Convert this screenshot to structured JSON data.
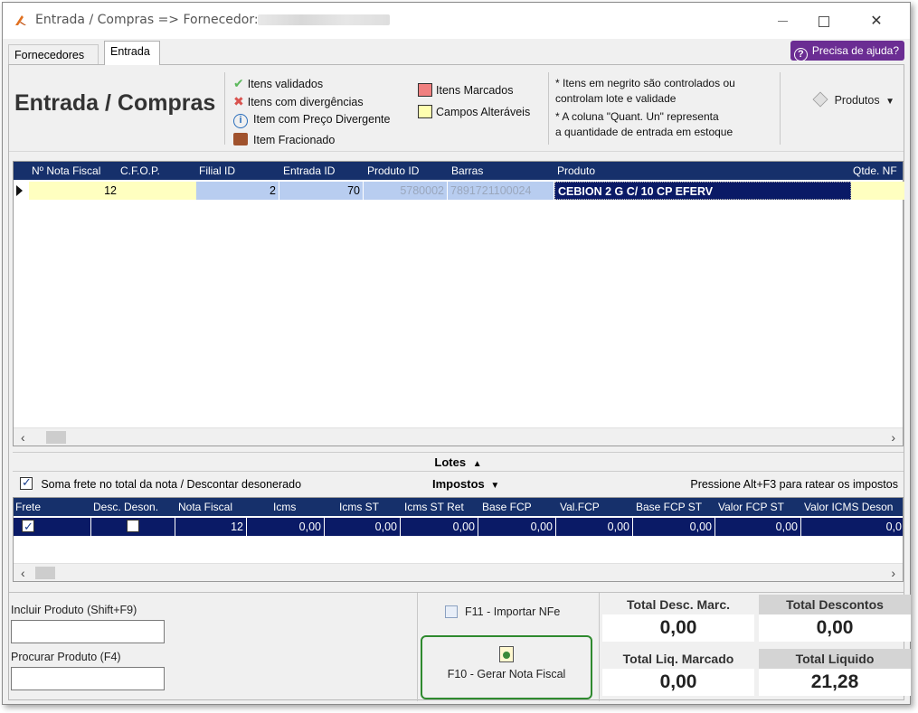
{
  "window": {
    "title": "Entrada / Compras => Fornecedor:",
    "minimize_label": "—",
    "maximize_label": "",
    "close_label": "✕"
  },
  "tabs": [
    {
      "label": "Fornecedores",
      "active": false
    },
    {
      "label": "Entrada",
      "active": true
    }
  ],
  "help": {
    "label": "Precisa de ajuda?",
    "icon": "question-circle-icon"
  },
  "header": {
    "title": "Entrada / Compras",
    "legend": {
      "validated": "Itens validados",
      "divergent": "Itens com divergências",
      "price_divergent": "Item com Preço Divergente",
      "fractioned": "Item Fracionado",
      "marked": "Itens Marcados",
      "editable": "Campos Alteráveis"
    },
    "legend_colors": {
      "marked": "#f08080",
      "editable": "#ffffb0"
    },
    "notes": [
      "* Itens em negrito são controlados ou",
      "controlam lote e validade",
      "* A coluna \"Quant. Un\" representa",
      "a quantidade de entrada em estoque"
    ],
    "produtos_label": "Produtos"
  },
  "items_grid": {
    "columns": [
      "Nº Nota Fiscal",
      "C.F.O.P.",
      "Filial ID",
      "Entrada ID",
      "Produto ID",
      "Barras",
      "Produto",
      "Qtde. NF"
    ],
    "rows": [
      {
        "nota_fiscal": "12",
        "cfop": "",
        "filial_id": "2",
        "entrada_id": "70",
        "produto_id": "5780002",
        "barras": "7891721100024",
        "produto": "CEBION 2 G C/ 10 CP EFERV",
        "qtde": ""
      }
    ]
  },
  "lotes": {
    "label": "Lotes"
  },
  "impostos": {
    "checkbox_label": "Soma frete no total da nota / Descontar desonerado",
    "checkbox_checked": true,
    "toggle_label": "Impostos",
    "hint": "Pressione Alt+F3 para ratear os impostos"
  },
  "tax_grid": {
    "columns": [
      "Frete",
      "Desc. Deson.",
      "Nota Fiscal",
      "Icms",
      "Icms ST",
      "Icms ST Ret",
      "Base FCP",
      "Val.FCP",
      "Base FCP ST",
      "Valor FCP ST",
      "Valor ICMS Deson"
    ],
    "rows": [
      {
        "frete": true,
        "desc_deson": false,
        "nota_fiscal": "12",
        "icms": "0,00",
        "icms_st": "0,00",
        "icms_st_ret": "0,00",
        "base_fcp": "0,00",
        "val_fcp": "0,00",
        "base_fcp_st": "0,00",
        "valor_fcp_st": "0,00",
        "valor_icms_deson": "0,0"
      }
    ]
  },
  "bottom": {
    "incluir_label": "Incluir Produto (Shift+F9)",
    "incluir_value": "",
    "procurar_label": "Procurar Produto (F4)",
    "procurar_value": "",
    "import_label": "F11 - Importar NFe",
    "gerar_label": "F10 - Gerar Nota Fiscal"
  },
  "totals": {
    "desc_marc_label": "Total Desc. Marc.",
    "desc_marc_value": "0,00",
    "descontos_label": "Total Descontos",
    "descontos_value": "0,00",
    "liq_marcado_label": "Total Liq. Marcado",
    "liq_marcado_value": "0,00",
    "liquido_label": "Total Liquido",
    "liquido_value": "21,28"
  }
}
